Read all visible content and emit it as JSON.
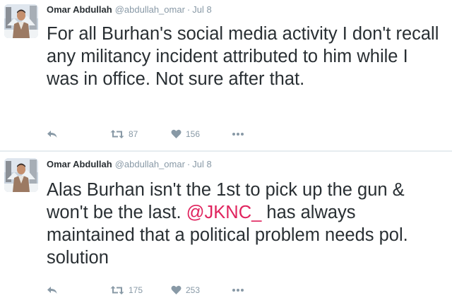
{
  "tweets": [
    {
      "author": {
        "name": "Omar Abdullah",
        "handle": "@abdullah_omar"
      },
      "separator": "·",
      "date": "Jul 8",
      "text_parts": [
        "For all Burhan's social media activity I don't recall any militancy incident attributed to him while I was in office. Not sure after that."
      ],
      "retweets": "87",
      "likes": "156"
    },
    {
      "author": {
        "name": "Omar Abdullah",
        "handle": "@abdullah_omar"
      },
      "separator": "·",
      "date": "Jul 8",
      "text_parts": [
        "Alas Burhan isn't the 1st to pick up the gun & won't be the last. ",
        "@JKNC_",
        " has always maintained that a political problem needs pol. solution"
      ],
      "retweets": "175",
      "likes": "253"
    }
  ],
  "icons": {
    "reply": "reply-icon",
    "retweet": "retweet-icon",
    "like": "heart-icon",
    "more": "more-dots-icon"
  },
  "colors": {
    "text": "#292f33",
    "meta": "#8899a6",
    "mention": "#e0245e",
    "divider": "#e6ecf0"
  }
}
